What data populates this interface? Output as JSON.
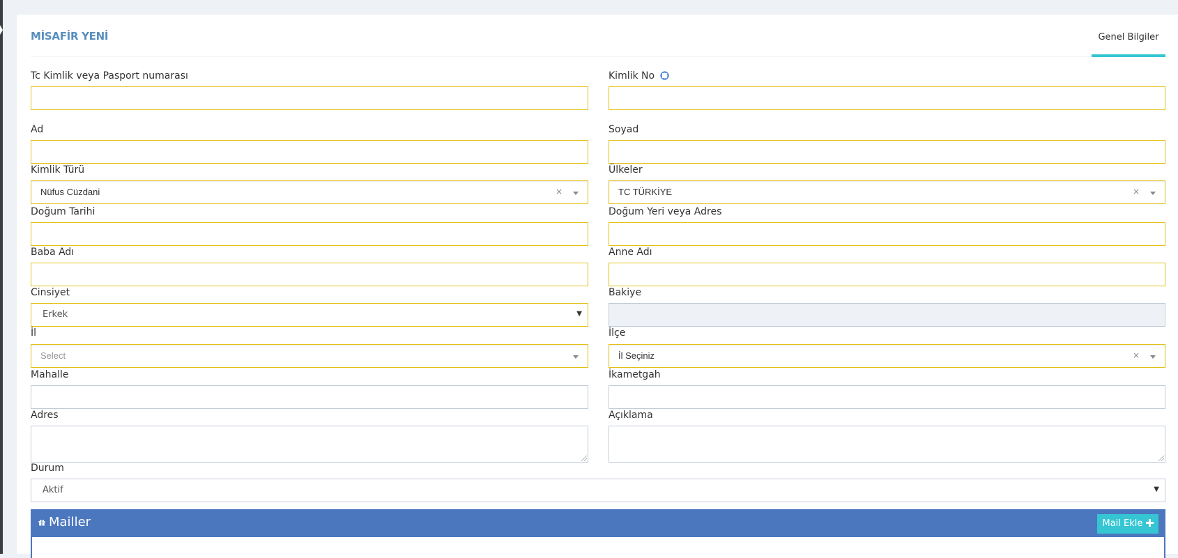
{
  "card": {
    "title": "MİSAFİR YENİ",
    "tab_label": "Genel Bilgiler"
  },
  "form": {
    "tc_kimlik": {
      "label": "Tc Kimlik veya Pasport numarası",
      "value": ""
    },
    "kimlik_no": {
      "label": "Kimlik No",
      "icon": "lifering-icon",
      "value": ""
    },
    "ad": {
      "label": "Ad",
      "value": ""
    },
    "soyad": {
      "label": "Soyad",
      "value": ""
    },
    "kimlik_turu": {
      "label": "Kimlik Türü",
      "value": "Nüfus Cüzdani",
      "clear": "×"
    },
    "ulkeler": {
      "label": "Ülkeler",
      "value": "TC TÜRKİYE",
      "clear": "×"
    },
    "dogum_tarihi": {
      "label": "Doğum Tarihi",
      "value": ""
    },
    "dogum_yeri": {
      "label": "Doğum Yeri veya Adres",
      "value": ""
    },
    "baba_adi": {
      "label": "Baba Adı",
      "value": ""
    },
    "anne_adi": {
      "label": "Anne Adı",
      "value": ""
    },
    "cinsiyet": {
      "label": "Cinsiyet",
      "value": "Erkek",
      "caret": "▼"
    },
    "bakiye": {
      "label": "Bakiye",
      "value": ""
    },
    "il": {
      "label": "İl",
      "placeholder": "Select"
    },
    "ilce": {
      "label": "İlçe",
      "value": "İl Seçiniz",
      "clear": "×"
    },
    "mahalle": {
      "label": "Mahalle",
      "value": ""
    },
    "ikametgah": {
      "label": "İkametgah",
      "value": ""
    },
    "adres": {
      "label": "Adres",
      "value": ""
    },
    "aciklama": {
      "label": "Açıklama",
      "value": ""
    },
    "durum": {
      "label": "Durum",
      "value": "Aktif",
      "caret": "▼"
    }
  },
  "mailler": {
    "title": "Mailler",
    "icon": "gift-icon",
    "add_button": "Mail Ekle",
    "add_icon": "plus-icon",
    "colors": {
      "bar": "#4b77be",
      "button": "#36c6d3"
    }
  },
  "colors": {
    "title": "#578ebe",
    "tab_underline": "#36c6d3",
    "field_border_active": "#e1c017",
    "field_border_default": "#c2cad8",
    "page_bg": "#eef1f5"
  }
}
